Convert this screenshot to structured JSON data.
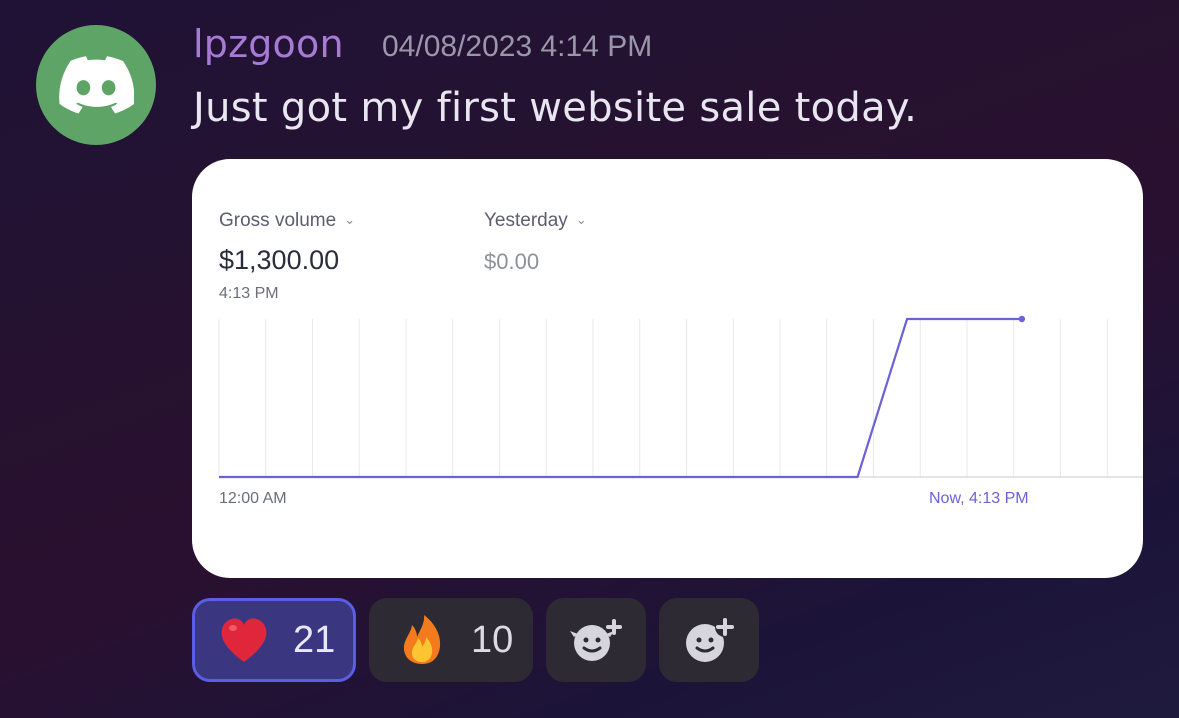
{
  "message": {
    "username": "lpzgoon",
    "timestamp": "04/08/2023 4:14 PM",
    "text": "Just got my first website sale today."
  },
  "avatar": {
    "icon": "discord-logo-icon",
    "color": "#5ea466"
  },
  "embed": {
    "primary_metric": {
      "label": "Gross volume",
      "value": "$1,300.00",
      "time": "4:13 PM"
    },
    "comparison_metric": {
      "label": "Yesterday",
      "value": "$0.00"
    },
    "axis": {
      "start_label": "12:00 AM",
      "end_label": "Now, 4:13 PM"
    },
    "line_color": "#6a62d6"
  },
  "reactions": [
    {
      "emoji": "heart",
      "count": "21",
      "active": true
    },
    {
      "emoji": "fire",
      "count": "10",
      "active": false
    },
    {
      "emoji": "add-super-reaction-icon",
      "count": "",
      "active": false
    },
    {
      "emoji": "add-reaction-icon",
      "count": "",
      "active": false
    }
  ],
  "chart_data": {
    "type": "line",
    "x_start": "12:00 AM",
    "x_end": "Now, 4:13 PM",
    "x_hours": [
      0,
      12.9,
      13.9,
      16.22
    ],
    "values": [
      0,
      0,
      1300,
      1300
    ],
    "title": "Gross volume",
    "grid": true
  }
}
